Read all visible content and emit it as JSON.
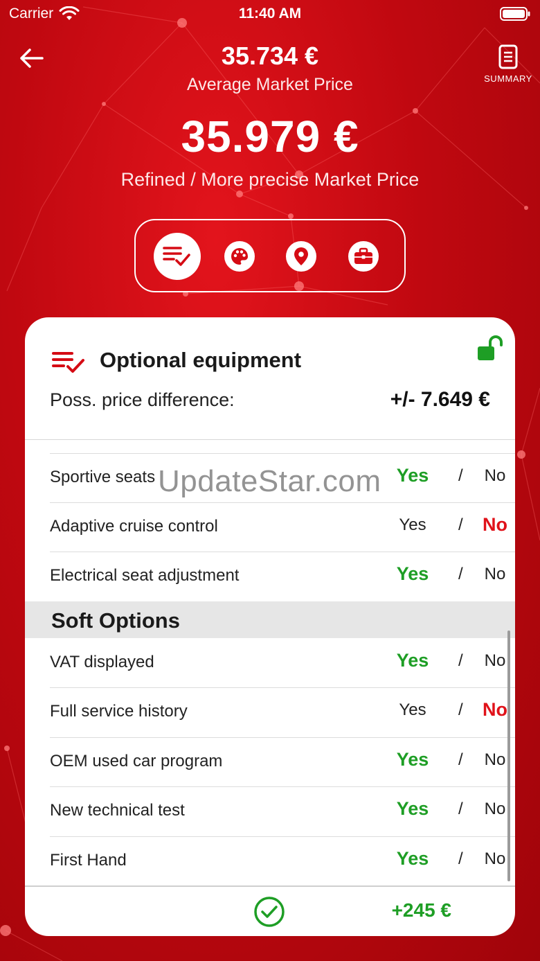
{
  "status_bar": {
    "carrier": "Carrier",
    "time": "11:40 AM"
  },
  "header": {
    "average_price": "35.734 €",
    "average_label": "Average Market Price",
    "refined_price": "35.979 €",
    "refined_label": "Refined / More precise Market Price",
    "summary_label": "SUMMARY"
  },
  "tabs": [
    {
      "icon": "checklist-icon",
      "selected": true
    },
    {
      "icon": "palette-icon",
      "selected": false
    },
    {
      "icon": "location-pin-icon",
      "selected": false
    },
    {
      "icon": "briefcase-icon",
      "selected": false
    }
  ],
  "card": {
    "title": "Optional equipment",
    "price_difference_label": "Poss. price difference:",
    "price_difference_value": "+/- 7.649 €",
    "yes_label": "Yes",
    "no_label": "No",
    "separator": "/",
    "rows": [
      {
        "label": "Sportive seats",
        "value": "Yes"
      },
      {
        "label": "Adaptive cruise control",
        "value": "No"
      },
      {
        "label": "Electrical seat adjustment",
        "value": "Yes"
      }
    ],
    "section_title": "Soft Options",
    "soft_rows": [
      {
        "label": "VAT displayed",
        "value": "Yes"
      },
      {
        "label": "Full service history",
        "value": "No"
      },
      {
        "label": "OEM used car program",
        "value": "Yes"
      },
      {
        "label": "New technical test",
        "value": "Yes"
      },
      {
        "label": "First Hand",
        "value": "Yes"
      }
    ],
    "total_value": "+245 €"
  },
  "watermark": "UpdateStar.com",
  "colors": {
    "brand_red": "#d50b14",
    "yes_green": "#1e9e25",
    "no_red": "#e0121a",
    "lock_green": "#1e9e25"
  }
}
